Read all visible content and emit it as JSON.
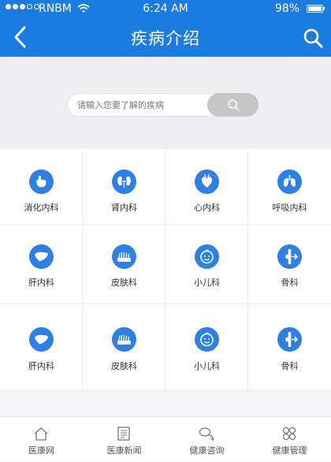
{
  "status_bar": {
    "carrier": "RNBM",
    "time": "6:24 AM",
    "battery_pct": "98%",
    "battery_level": 0.98
  },
  "header": {
    "title": "疾病介绍",
    "back_icon": "chevron-left-icon",
    "search_icon": "search-icon"
  },
  "search": {
    "placeholder": "请输入您要了解的疾病",
    "button_icon": "search-icon"
  },
  "departments": [
    {
      "label": "消化内科",
      "icon": "stomach-icon"
    },
    {
      "label": "肾内科",
      "icon": "kidney-icon"
    },
    {
      "label": "心内科",
      "icon": "heart-icon"
    },
    {
      "label": "呼吸内科",
      "icon": "lungs-icon"
    },
    {
      "label": "肝内科",
      "icon": "liver-icon"
    },
    {
      "label": "皮肤科",
      "icon": "skin-icon"
    },
    {
      "label": "小儿科",
      "icon": "baby-face-icon"
    },
    {
      "label": "骨科",
      "icon": "bone-icon"
    },
    {
      "label": "肝内科",
      "icon": "liver-icon"
    },
    {
      "label": "皮肤科",
      "icon": "skin-icon"
    },
    {
      "label": "小儿科",
      "icon": "baby-face-icon"
    },
    {
      "label": "骨科",
      "icon": "bone-icon"
    }
  ],
  "tabbar": [
    {
      "label": "医康网",
      "icon": "home-icon"
    },
    {
      "label": "医康新闻",
      "icon": "news-icon"
    },
    {
      "label": "健康咨询",
      "icon": "chat-icon"
    },
    {
      "label": "健康管理",
      "icon": "grid-icon"
    }
  ],
  "colors": {
    "primary": "#1a7be0",
    "icon_bg": "#2c80e6",
    "search_button": "#c6c6c6"
  }
}
